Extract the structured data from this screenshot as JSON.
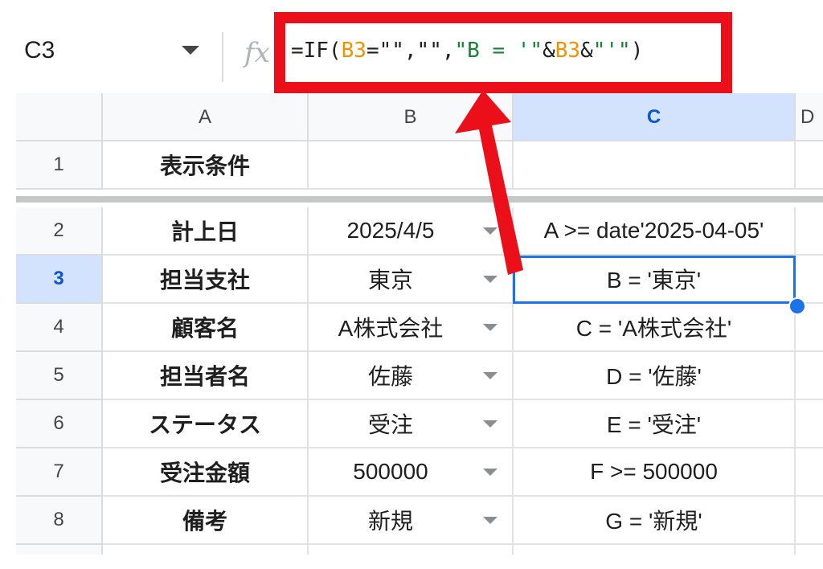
{
  "formula_bar": {
    "name_box": "C3",
    "fx_label": "fx",
    "formula_parts": {
      "p1": "=IF(",
      "p2": "B3",
      "p3": "=\"\",\"\",",
      "p4": "\"B = '\"",
      "p5": "&",
      "p6": "B3",
      "p7": "&",
      "p8": "\"'\"",
      "p9": ")"
    }
  },
  "columns": [
    "A",
    "B",
    "C",
    "D"
  ],
  "rows": [
    {
      "num": "1",
      "a": "表示条件",
      "b": "",
      "c": ""
    },
    {
      "num": "2",
      "a": "計上日",
      "b": "2025/4/5",
      "c": "A >= date'2025-04-05'"
    },
    {
      "num": "3",
      "a": "担当支社",
      "b": "東京",
      "c": "B = '東京'"
    },
    {
      "num": "4",
      "a": "顧客名",
      "b": "A株式会社",
      "c": "C = 'A株式会社'"
    },
    {
      "num": "5",
      "a": "担当者名",
      "b": "佐藤",
      "c": "D = '佐藤'"
    },
    {
      "num": "6",
      "a": "ステータス",
      "b": "受注",
      "c": "E = '受注'"
    },
    {
      "num": "7",
      "a": "受注金額",
      "b": "500000",
      "c": "F >= 500000"
    },
    {
      "num": "8",
      "a": "備考",
      "b": "新規",
      "c": "G = '新規'"
    }
  ],
  "colors": {
    "highlight_frame": "#ea0f19",
    "selection": "#1a73e8",
    "string_token": "#188038",
    "reference_token": "#f09300"
  }
}
